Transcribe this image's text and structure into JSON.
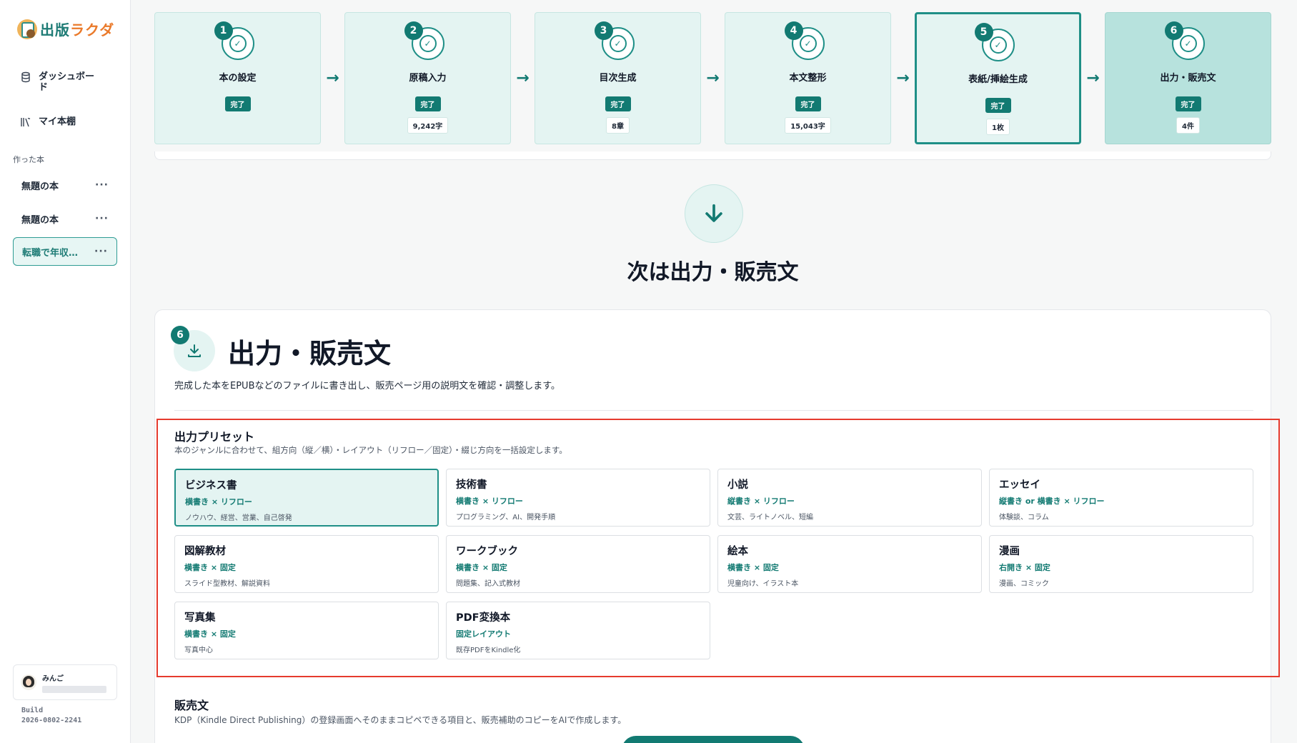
{
  "app": {
    "logo_a": "出版",
    "logo_b": "ラクダ"
  },
  "sidebar": {
    "nav": [
      {
        "label": "ダッシュボード",
        "icon": "database-icon"
      },
      {
        "label": "マイ本棚",
        "icon": "bookshelf-icon"
      }
    ],
    "section_label": "作った本",
    "books": [
      {
        "title": "無題の本",
        "active": false
      },
      {
        "title": "無題の本",
        "active": false
      },
      {
        "title": "転職で年収…",
        "active": true
      }
    ],
    "more": "···",
    "user": {
      "name": "みんご"
    },
    "build": {
      "label": "Build",
      "value": "2026-0802-2241"
    }
  },
  "stepper": {
    "steps": [
      {
        "num": "1",
        "title": "本の設定",
        "badge": "完了",
        "meta": ""
      },
      {
        "num": "2",
        "title": "原稿入力",
        "badge": "完了",
        "meta": "9,242字"
      },
      {
        "num": "3",
        "title": "目次生成",
        "badge": "完了",
        "meta": "8章"
      },
      {
        "num": "4",
        "title": "本文整形",
        "badge": "完了",
        "meta": "15,043字"
      },
      {
        "num": "5",
        "title": "表紙/挿絵生成",
        "badge": "完了",
        "meta": "1枚"
      },
      {
        "num": "6",
        "title": "出力・販売文",
        "badge": "完了",
        "meta": "4件"
      }
    ],
    "arrow": "→"
  },
  "next": {
    "title": "次は出力・販売文"
  },
  "output": {
    "num": "6",
    "title": "出力・販売文",
    "desc": "完成した本をEPUBなどのファイルに書き出し、販売ページ用の説明文を確認・調整します。"
  },
  "presets": {
    "title": "出力プリセット",
    "desc": "本のジャンルに合わせて、組方向（縦／横）・レイアウト（リフロー／固定）・綴じ方向を一括設定します。",
    "items": [
      {
        "name": "ビジネス書",
        "spec": "横書き × リフロー",
        "examples": "ノウハウ、経営、営業、自己啓発",
        "selected": true
      },
      {
        "name": "技術書",
        "spec": "横書き × リフロー",
        "examples": "プログラミング、AI、開発手順",
        "selected": false
      },
      {
        "name": "小説",
        "spec": "縦書き × リフロー",
        "examples": "文芸、ライトノベル、短編",
        "selected": false
      },
      {
        "name": "エッセイ",
        "spec": "縦書き or 横書き × リフロー",
        "examples": "体験談、コラム",
        "selected": false
      },
      {
        "name": "図解教材",
        "spec": "横書き × 固定",
        "examples": "スライド型教材、解説資料",
        "selected": false
      },
      {
        "name": "ワークブック",
        "spec": "横書き × 固定",
        "examples": "問題集、記入式教材",
        "selected": false
      },
      {
        "name": "絵本",
        "spec": "横書き × 固定",
        "examples": "児童向け、イラスト本",
        "selected": false
      },
      {
        "name": "漫画",
        "spec": "右開き × 固定",
        "examples": "漫画、コミック",
        "selected": false
      },
      {
        "name": "写真集",
        "spec": "横書き × 固定",
        "examples": "写真中心",
        "selected": false
      },
      {
        "name": "PDF変換本",
        "spec": "固定レイアウト",
        "examples": "既存PDFをKindle化",
        "selected": false
      }
    ]
  },
  "sales": {
    "title": "販売文",
    "desc": "KDP（Kindle Direct Publishing）の登録画面へそのままコピペできる項目と、販売補助のコピーをAIで作成します。"
  },
  "colors": {
    "accent": "#127a72",
    "highlight": "#e63b2e"
  }
}
